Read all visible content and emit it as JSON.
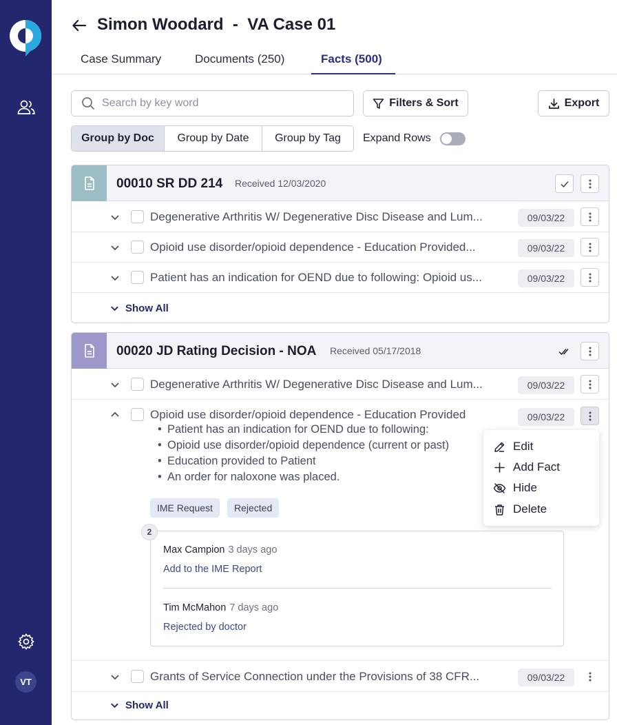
{
  "header": {
    "title": "Simon Woodard  -  VA Case 01"
  },
  "tabs": [
    {
      "label": "Case Summary"
    },
    {
      "label": "Documents (250)"
    },
    {
      "label": "Facts (500)",
      "active": true
    }
  ],
  "toolbar": {
    "search_placeholder": "Search by key word",
    "filters_label": "Filters & Sort",
    "export_label": "Export",
    "group_options": [
      "Group by Doc",
      "Group by Date",
      "Group by Tag"
    ],
    "group_selected": "Group by Doc",
    "expand_rows_label": "Expand Rows",
    "expand_rows_on": false
  },
  "user": {
    "initials": "VT"
  },
  "documents": [
    {
      "title": "00010 SR DD 214",
      "received": "Received 12/03/2020",
      "icon_color": "#9bbdc4",
      "facts": [
        {
          "text": "Degenerative Arthritis W/ Degenerative Disc Disease and Lum...",
          "date": "09/03/22"
        },
        {
          "text": "Opioid use disorder/opioid dependence - Education Provided...",
          "date": "09/03/22"
        },
        {
          "text": "Patient has an indication for OEND due to following: Opioid us...",
          "date": "09/03/22"
        }
      ],
      "show_all": "Show All"
    },
    {
      "title": "00020 JD Rating Decision - NOA",
      "received": "Received 05/17/2018",
      "icon_color": "#9c98c9",
      "facts": [
        {
          "text": "Degenerative Arthritis W/ Degenerative Disc Disease and Lum...",
          "date": "09/03/22"
        },
        {
          "text": "Opioid use disorder/opioid dependence - Education Provided",
          "date": "09/03/22",
          "expanded": true,
          "bullets": [
            "Patient has an indication for OEND due to following:",
            "Opioid use disorder/opioid dependence (current or past)",
            "Education provided to Patient",
            "An order for naloxone was placed."
          ],
          "tags": [
            "IME Request",
            "Rejected"
          ],
          "comment_count": "2",
          "comments": [
            {
              "author": "Max Campion",
              "time": "3 days ago",
              "body": "Add to the IME Report"
            },
            {
              "author": "Tim McMahon",
              "time": "7 days ago",
              "body": "Rejected by doctor"
            }
          ]
        },
        {
          "text": "Grants of Service Connection under the Provisions of 38 CFR...",
          "date": "09/03/22"
        }
      ],
      "show_all": "Show All"
    }
  ],
  "context_menu": {
    "items": [
      {
        "label": "Edit",
        "icon": "pencil-icon"
      },
      {
        "label": "Add Fact",
        "icon": "plus-icon"
      },
      {
        "label": "Hide",
        "icon": "eye-off-icon"
      },
      {
        "label": "Delete",
        "icon": "trash-icon"
      }
    ]
  },
  "colors": {
    "sidebar": "#23286e",
    "accent": "#2a2f83",
    "logo_blue": "#2aa8e0"
  }
}
